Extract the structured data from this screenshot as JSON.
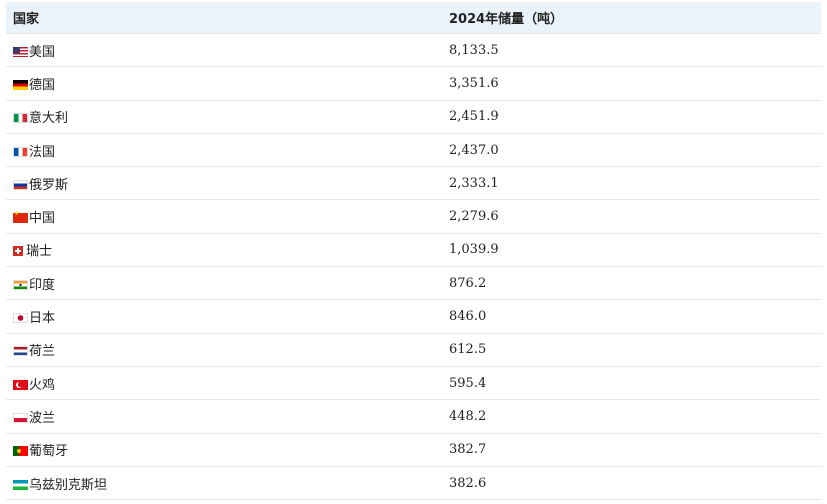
{
  "table": {
    "headers": {
      "country": "国家",
      "reserves": "2024年储量（吨）"
    },
    "rows": [
      {
        "flag": "us-flag-icon",
        "country": "美国",
        "reserves": "8,133.5"
      },
      {
        "flag": "de-flag-icon",
        "country": "德国",
        "reserves": "3,351.6"
      },
      {
        "flag": "it-flag-icon",
        "country": "意大利",
        "reserves": "2,451.9"
      },
      {
        "flag": "fr-flag-icon",
        "country": "法国",
        "reserves": "2,437.0"
      },
      {
        "flag": "ru-flag-icon",
        "country": "俄罗斯",
        "reserves": "2,333.1"
      },
      {
        "flag": "cn-flag-icon",
        "country": "中国",
        "reserves": "2,279.6"
      },
      {
        "flag": "ch-flag-icon",
        "country": "瑞士",
        "reserves": "1,039.9"
      },
      {
        "flag": "in-flag-icon",
        "country": "印度",
        "reserves": "876.2"
      },
      {
        "flag": "jp-flag-icon",
        "country": "日本",
        "reserves": "846.0"
      },
      {
        "flag": "nl-flag-icon",
        "country": "荷兰",
        "reserves": "612.5"
      },
      {
        "flag": "tr-flag-icon",
        "country": "火鸡",
        "reserves": "595.4"
      },
      {
        "flag": "pl-flag-icon",
        "country": "波兰",
        "reserves": "448.2"
      },
      {
        "flag": "pt-flag-icon",
        "country": "葡萄牙",
        "reserves": "382.7"
      },
      {
        "flag": "uz-flag-icon",
        "country": "乌兹别克斯坦",
        "reserves": "382.6"
      }
    ]
  },
  "colors": {
    "header_bg": "#e9f3f9",
    "row_border": "#e6e6e6"
  }
}
